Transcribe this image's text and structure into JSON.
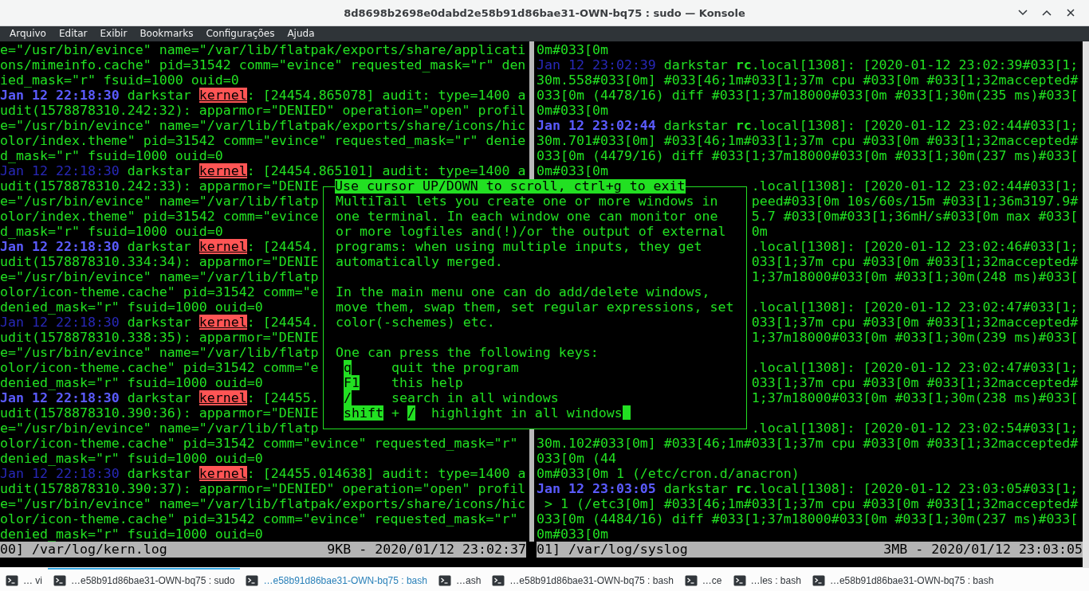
{
  "window": {
    "title": "8d8698b2698e0dabd2e58b91d86bae31-OWN-bq75 : sudo — Konsole"
  },
  "menu": [
    "Arquivo",
    "Editar",
    "Exibir",
    "Bookmarks",
    "Configurações",
    "Ajuda"
  ],
  "panes": [
    {
      "lines": [
        {
          "kind": "plain",
          "text": "e=\"/usr/bin/evince\" name=\"/var/lib/flatpak/exports/share/applicati"
        },
        {
          "kind": "plain",
          "text": "ons/mimeinfo.cache\" pid=31542 comm=\"evince\" requested_mask=\"r\" den"
        },
        {
          "kind": "plain",
          "text": "ied_mask=\"r\" fsuid=1000 ouid=0"
        },
        {
          "kind": "entry",
          "date": "Jan 12 22:18:30",
          "date_bold": true,
          "host": "darkstar",
          "source": "kernel",
          "source_highlighted": true,
          "rest": ": [24454.865078] audit: type=1400 a"
        },
        {
          "kind": "plain",
          "text": "udit(1578878310.242:32): apparmor=\"DENIED\" operation=\"open\" profil"
        },
        {
          "kind": "plain",
          "text": "e=\"/usr/bin/evince\" name=\"/var/lib/flatpak/exports/share/icons/hic"
        },
        {
          "kind": "plain",
          "text": "olor/index.theme\" pid=31542 comm=\"evince\" requested_mask=\"r\" denie"
        },
        {
          "kind": "plain",
          "text": "d_mask=\"r\" fsuid=1000 ouid=0"
        },
        {
          "kind": "entry",
          "date": "Jan 12 22:18:30",
          "date_bold": false,
          "host": "darkstar",
          "source": "kernel",
          "source_highlighted": true,
          "rest": ": [24454.865101] audit: type=1400 a"
        },
        {
          "kind": "plain",
          "text": "udit(1578878310.242:33): apparmor=\"DENIE"
        },
        {
          "kind": "plain",
          "text": "e=\"/usr/bin/evince\" name=\"/var/lib/flatp"
        },
        {
          "kind": "plain",
          "text": "olor/index.theme\" pid=31542 comm=\"evince"
        },
        {
          "kind": "plain",
          "text": "d_mask=\"r\" fsuid=1000 ouid=0"
        },
        {
          "kind": "entry",
          "date": "Jan 12 22:18:30",
          "date_bold": true,
          "host": "darkstar",
          "source": "kernel",
          "source_highlighted": true,
          "rest": ": [24454."
        },
        {
          "kind": "plain",
          "text": "udit(1578878310.334:34): apparmor=\"DENIE"
        },
        {
          "kind": "plain",
          "text": "e=\"/usr/bin/evince\" name=\"/var/lib/flatp"
        },
        {
          "kind": "plain",
          "text": "olor/icon-theme.cache\" pid=31542 comm=\"e"
        },
        {
          "kind": "plain",
          "text": "denied_mask=\"r\" fsuid=1000 ouid=0"
        },
        {
          "kind": "entry",
          "date": "Jan 12 22:18:30",
          "date_bold": false,
          "host": "darkstar",
          "source": "kernel",
          "source_highlighted": true,
          "rest": ": [24454."
        },
        {
          "kind": "plain",
          "text": "udit(1578878310.338:35): apparmor=\"DENIE"
        },
        {
          "kind": "plain",
          "text": "e=\"/usr/bin/evince\" name=\"/var/lib/flatp"
        },
        {
          "kind": "plain",
          "text": "olor/icon-theme.cache\" pid=31542 comm=\"e"
        },
        {
          "kind": "plain",
          "text": "denied_mask=\"r\" fsuid=1000 ouid=0"
        },
        {
          "kind": "entry",
          "date": "Jan 12 22:18:30",
          "date_bold": true,
          "host": "darkstar",
          "source": "kernel",
          "source_highlighted": true,
          "rest": ": [24455."
        },
        {
          "kind": "plain",
          "text": "udit(1578878310.390:36): apparmor=\"DENIE"
        },
        {
          "kind": "plain",
          "text": "e=\"/usr/bin/evince\" name=\"/var/lib/flatp"
        },
        {
          "kind": "plain",
          "text": "olor/icon-theme.cache\" pid=31542 comm=\"evince\" requested_mask=\"r\""
        },
        {
          "kind": "plain",
          "text": "denied_mask=\"r\" fsuid=1000 ouid=0"
        },
        {
          "kind": "entry",
          "date": "Jan 12 22:18:30",
          "date_bold": false,
          "host": "darkstar",
          "source": "kernel",
          "source_highlighted": true,
          "rest": ": [24455.014638] audit: type=1400 a"
        },
        {
          "kind": "plain",
          "text": "udit(1578878310.390:37): apparmor=\"DENIED\" operation=\"open\" profil"
        },
        {
          "kind": "plain",
          "text": "e=\"/usr/bin/evince\" name=\"/var/lib/flatpak/exports/share/icons/hic"
        },
        {
          "kind": "plain",
          "text": "olor/icon-theme.cache\" pid=31542 comm=\"evince\" requested_mask=\"r\""
        },
        {
          "kind": "plain",
          "text": "denied_mask=\"r\" fsuid=1000 ouid=0"
        }
      ],
      "status": {
        "file": "00] /var/log/kern.log",
        "info": "9KB - 2020/01/12 23:02:37"
      }
    },
    {
      "lines": [
        {
          "kind": "plain",
          "covered": false,
          "text": "0m#033[0m"
        },
        {
          "kind": "entry",
          "covered": false,
          "date": "Jan 12 23:02:39",
          "date_bold": false,
          "host": "darkstar",
          "source": "rc",
          "source_highlighted": false,
          "rest": ".local[1308]: [2020-01-12 23:02:39#033[1;"
        },
        {
          "kind": "plain",
          "covered": false,
          "text": "30m.558#033[0m] #033[46;1m#033[1;37m cpu #033[0m #033[1;32maccepted#"
        },
        {
          "kind": "plain",
          "covered": false,
          "text": "033[0m (4478/16) diff #033[1;37m18000#033[0m #033[1;30m(235 ms)#033["
        },
        {
          "kind": "plain",
          "covered": false,
          "text": "0m#033[0m"
        },
        {
          "kind": "entry",
          "covered": false,
          "date": "Jan 12 23:02:44",
          "date_bold": true,
          "host": "darkstar",
          "source": "rc",
          "source_highlighted": false,
          "rest": ".local[1308]: [2020-01-12 23:02:44#033[1;"
        },
        {
          "kind": "plain",
          "covered": false,
          "text": "30m.701#033[0m] #033[46;1m#033[1;37m cpu #033[0m #033[1;32maccepted#"
        },
        {
          "kind": "plain",
          "covered": false,
          "text": "033[0m (4479/16) diff #033[1;37m18000#033[0m #033[1;30m(237 ms)#033["
        },
        {
          "kind": "plain",
          "covered": false,
          "text": "0m#033[0m"
        },
        {
          "kind": "plain",
          "covered": true,
          "text": ".local[1308]: [2020-01-12 23:02:44#033[1;"
        },
        {
          "kind": "plain",
          "covered": true,
          "text": "peed#033[0m 10s/60s/15m #033[1;36m3197.9#"
        },
        {
          "kind": "plain",
          "covered": true,
          "text": "5.7 #033[0m#033[1;36mH/s#033[0m max #033["
        },
        {
          "kind": "plain",
          "covered": true,
          "text": "0m"
        },
        {
          "kind": "plain",
          "covered": true,
          "text": ".local[1308]: [2020-01-12 23:02:46#033[1;"
        },
        {
          "kind": "plain",
          "covered": true,
          "text": "033[1;37m cpu #033[0m #033[1;32maccepted#"
        },
        {
          "kind": "plain",
          "covered": true,
          "text": "1;37m18000#033[0m #033[1;30m(248 ms)#033["
        },
        {
          "kind": "blank"
        },
        {
          "kind": "plain",
          "covered": true,
          "text": ".local[1308]: [2020-01-12 23:02:47#033[1;"
        },
        {
          "kind": "plain",
          "covered": true,
          "text": "033[1;37m cpu #033[0m #033[1;32maccepted#"
        },
        {
          "kind": "plain",
          "covered": true,
          "text": "1;37m18000#033[0m #033[1;30m(239 ms)#033["
        },
        {
          "kind": "blank"
        },
        {
          "kind": "plain",
          "covered": true,
          "text": ".local[1308]: [2020-01-12 23:02:47#033[1;"
        },
        {
          "kind": "plain",
          "covered": true,
          "text": "033[1;37m cpu #033[0m #033[1;32maccepted#"
        },
        {
          "kind": "plain",
          "covered": true,
          "text": "1;37m18000#033[0m #033[1;30m(238 ms)#033["
        },
        {
          "kind": "blank"
        },
        {
          "kind": "plain",
          "covered": true,
          "text": ".local[1308]: [2020-01-12 23:02:54#033[1;"
        },
        {
          "kind": "plain",
          "covered": false,
          "text": "30m.102#033[0m] #033[46;1m#033[1;37m cpu #033[0m #033[1;32maccepted#"
        },
        {
          "kind": "plain",
          "covered": false,
          "text": "033[0m (44"
        },
        {
          "kind": "plain",
          "covered": false,
          "text": "0m#033[0m 1 (/etc/cron.d/anacron)"
        },
        {
          "kind": "entry",
          "covered": false,
          "date": "Jan 12 23:03:05",
          "date_bold": true,
          "host": "darkstar",
          "source": "rc",
          "source_highlighted": false,
          "rest": ".local[1308]: [2020-01-12 23:03:05#033[1;"
        },
        {
          "kind": "plain",
          "covered": false,
          "text": " > 1 (/etc3[0m] #033[46;1m#033[1;37m cpu #033[0m #033[1;32maccepted#"
        },
        {
          "kind": "plain",
          "covered": false,
          "text": "033[0m (4484/16) diff #033[1;37m18000#033[0m #033[1;30m(237 ms)#033["
        },
        {
          "kind": "plain",
          "covered": false,
          "text": "0m#033[0m"
        }
      ],
      "status": {
        "file": "01] /var/log/syslog",
        "info": "3MB - 2020/01/12 23:03:05"
      }
    }
  ],
  "help": {
    "title": "Use cursor UP/DOWN to scroll, ctrl+g to exit",
    "paragraphs": [
      [
        "MultiTail lets you create one or more windows in",
        "one terminal. In each window one can monitor one",
        "or more logfiles and(!)/or the output of external",
        "programs: when using multiple inputs, they get",
        "automatically merged."
      ],
      [
        "In the main menu one can do add/delete windows,",
        "move them, swap them, set regular expressions, set",
        "color(-schemes) etc."
      ],
      [
        "One can press the following keys:"
      ]
    ],
    "keys": [
      {
        "parts": [
          {
            "kind": "key",
            "text": "q"
          }
        ],
        "description": "quit the program"
      },
      {
        "parts": [
          {
            "kind": "key",
            "text": "F1"
          }
        ],
        "description": "this help"
      },
      {
        "parts": [
          {
            "kind": "key",
            "text": "/"
          }
        ],
        "description": "search in all windows"
      },
      {
        "parts": [
          {
            "kind": "key",
            "text": "shift"
          },
          {
            "kind": "plain",
            "text": "+"
          },
          {
            "kind": "key",
            "text": "/"
          }
        ],
        "description": "highlight in all windows"
      }
    ],
    "cursor": true
  },
  "taskbar": {
    "tabs": [
      {
        "label": "… vi",
        "selected": false,
        "attention": false
      },
      {
        "label": "…e58b91d86bae31-OWN-bq75 : sudo",
        "selected": true,
        "attention": false
      },
      {
        "label": "…e58b91d86bae31-OWN-bq75 : bash",
        "selected": false,
        "attention": true
      },
      {
        "label": "…ash",
        "selected": false,
        "attention": false
      },
      {
        "label": "…e58b91d86bae31-OWN-bq75 : bash",
        "selected": false,
        "attention": false
      },
      {
        "label": "…ce",
        "selected": false,
        "attention": false
      },
      {
        "label": "…les : bash",
        "selected": false,
        "attention": false
      },
      {
        "label": "…e58b91d86bae31-OWN-bq75 : bash",
        "selected": false,
        "attention": false
      }
    ]
  }
}
